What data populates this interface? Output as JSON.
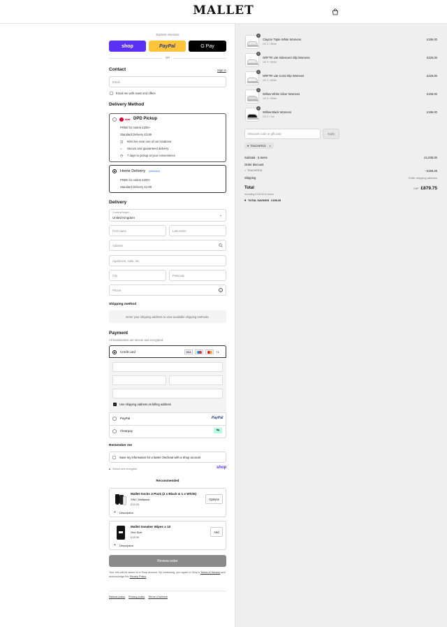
{
  "brand": {
    "logo": "MALLET"
  },
  "express": {
    "label": "Express checkout",
    "or": "OR",
    "shop_pay": "shop",
    "paypal": "PayPal",
    "gpay": "G Pay"
  },
  "contact": {
    "title": "Contact",
    "sign_in": "Sign in",
    "email_placeholder": "Email",
    "news_label": "Email me with news and offers"
  },
  "delivery_method": {
    "title": "Delivery Method",
    "pickup": {
      "brand_mark": "dpd",
      "label": "DPD Pickup",
      "free_line": "FREE for orders £200+",
      "standard_line": "Standard Delivery £3.99",
      "features": [
        "94% live near one of our locations",
        "Secure and guaranteed delivery",
        "7 days to pickup at your convenience"
      ]
    },
    "home": {
      "label": "Home Delivery",
      "tag": "(selected)",
      "free_line": "FREE for orders £200+",
      "standard_line": "Standard Delivery £4.99"
    }
  },
  "delivery": {
    "title": "Delivery",
    "country_label": "Country/Region",
    "country_value": "United Kingdom",
    "first_name": "First name",
    "last_name": "Last name",
    "address": "Address",
    "apartment": "Apartment, suite, etc.",
    "city": "City",
    "postcode": "Postcode",
    "phone": "Phone"
  },
  "shipping": {
    "title": "Shipping method",
    "notice": "Enter your shipping address to view available shipping methods."
  },
  "payment": {
    "title": "Payment",
    "subtitle": "All transactions are secure and encrypted.",
    "credit_card": "Credit card",
    "more_cards": "+1",
    "billing_same": "Use shipping address as billing address",
    "paypal": "PayPal",
    "paypal_logo": "PayPal",
    "clearpay": "Clearpay"
  },
  "remember": {
    "title": "Remember me",
    "save_label": "Save my information for a faster checkout with a Shop account",
    "secure": "Secure and encrypted",
    "shop_logo": "shop"
  },
  "recommended": {
    "title": "Recommended",
    "items": [
      {
        "name": "Mallet Socks 3-Pack (2 x Black & 1 x White)",
        "variant": "S/M / Multipack",
        "price": "£15.00",
        "action": "Options",
        "desc": "Description"
      },
      {
        "name": "Mallet Sneaker Wipes x 10",
        "variant": "One Size",
        "price": "£15.00",
        "action": "Add",
        "desc": "Description"
      }
    ]
  },
  "review": {
    "button": "Review order",
    "legal_1": "Your info will be saved to a Shop account. By continuing, you agree to Shop's ",
    "terms": "Terms of Service",
    "legal_2": " and acknowledge the ",
    "privacy": "Privacy Policy",
    "legal_3": "."
  },
  "footer": {
    "links": [
      "Refund policy",
      "Privacy policy",
      "Terms of service"
    ]
  },
  "cart": {
    "items": [
      {
        "name": "Clayton Triple White Womens",
        "variant": "UK 3 / White",
        "price": "£195.00",
        "qty": "1",
        "shoe_color": "#e9e9e9",
        "sole_color": "#ffffff"
      },
      {
        "name": "GRFTR Lite Iridescent Slip Womens",
        "variant": "UK 3 / White",
        "price": "£225.00",
        "qty": "1",
        "shoe_color": "#ececec",
        "sole_color": "#f3f3f3"
      },
      {
        "name": "GRFTR Lite Coral Slip Womens",
        "variant": "UK 3 / White",
        "price": "£225.00",
        "qty": "1",
        "shoe_color": "#f1f1f1",
        "sole_color": "#e86b3f"
      },
      {
        "name": "Willow White Silver Womens",
        "variant": "UK 3 / White",
        "price": "£195.00",
        "qty": "1",
        "shoe_color": "#dcdcdc",
        "sole_color": "#f5f5f5"
      },
      {
        "name": "Willow Black Womens",
        "variant": "UK 3 / Tan",
        "price": "£195.00",
        "qty": "1",
        "shoe_color": "#161616",
        "sole_color": "#f2f2f2"
      }
    ],
    "discount_placeholder": "Discount code or gift card",
    "apply": "Apply",
    "applied_code": "TEACHER15",
    "subtotal_label": "Subtotal · 5 items",
    "subtotal_value": "£1,035.00",
    "order_discount_label": "Order discount",
    "discount_code": "TEACHER15",
    "discount_value": "−£155.25",
    "shipping_label": "Shipping",
    "shipping_value": "Enter shipping address",
    "total_label": "Total",
    "currency": "GBP",
    "total_value": "£879.75",
    "taxes": "Including £146.63 in taxes",
    "savings_label": "TOTAL SAVINGS",
    "savings_value": "£155.25"
  },
  "colors": {
    "shop_pay": "#5a31f4",
    "paypal": "#ffc439",
    "gpay": "#000000",
    "review_button": "#8a8a8a",
    "link": "#1a73e8"
  }
}
